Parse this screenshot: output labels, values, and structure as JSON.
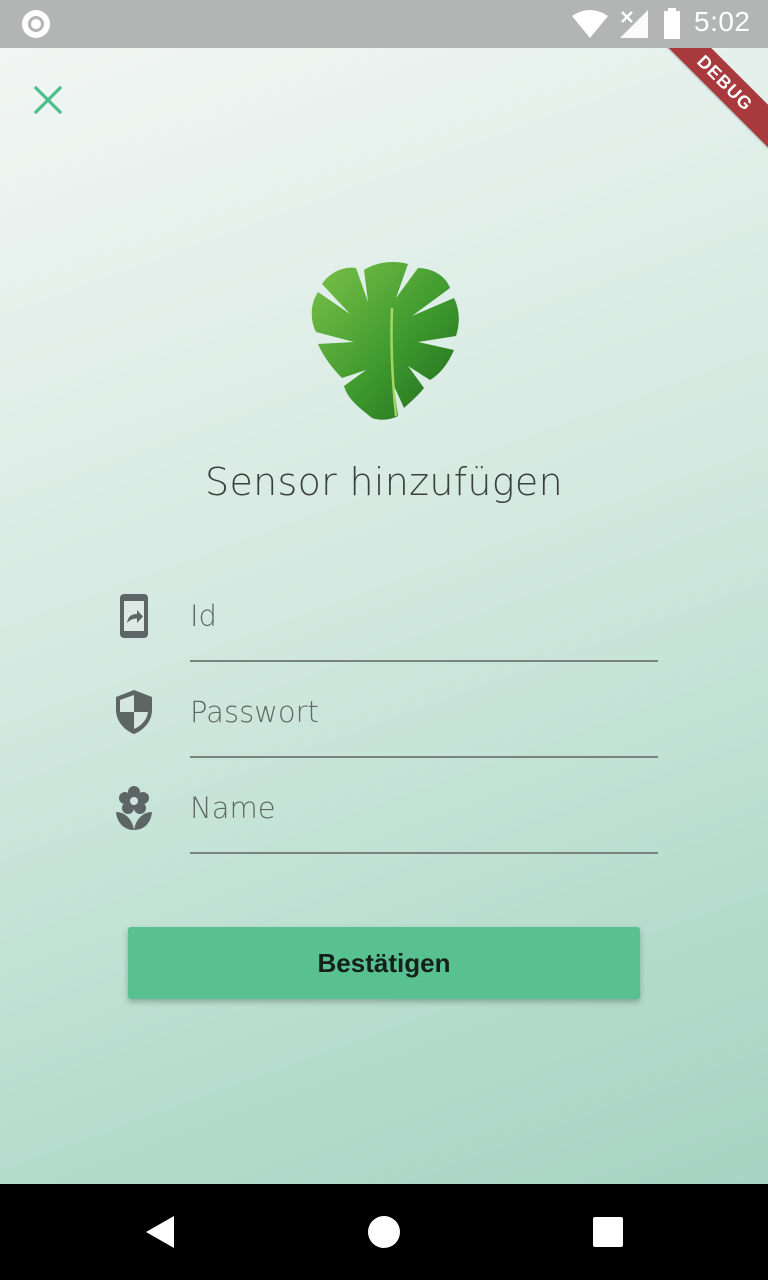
{
  "status_bar": {
    "time": "5:02",
    "icons": [
      "notification-icon",
      "wifi-icon",
      "signal-icon",
      "battery-icon"
    ]
  },
  "debug_banner": "DEBUG",
  "screen": {
    "title": "Sensor hinzufügen",
    "close_icon": "close-icon",
    "fields": [
      {
        "placeholder": "Id",
        "icon": "phone-forward-icon",
        "value": ""
      },
      {
        "placeholder": "Passwort",
        "icon": "shield-icon",
        "value": ""
      },
      {
        "placeholder": "Name",
        "icon": "flower-icon",
        "value": ""
      }
    ],
    "confirm_label": "Bestätigen"
  },
  "nav_bar": {
    "buttons": [
      "back-icon",
      "home-icon",
      "recents-icon"
    ]
  },
  "colors": {
    "accent": "#58c18f",
    "close_icon": "#4cbf8c",
    "icon_gray": "#5d6664",
    "debug": "#a83a3e"
  }
}
